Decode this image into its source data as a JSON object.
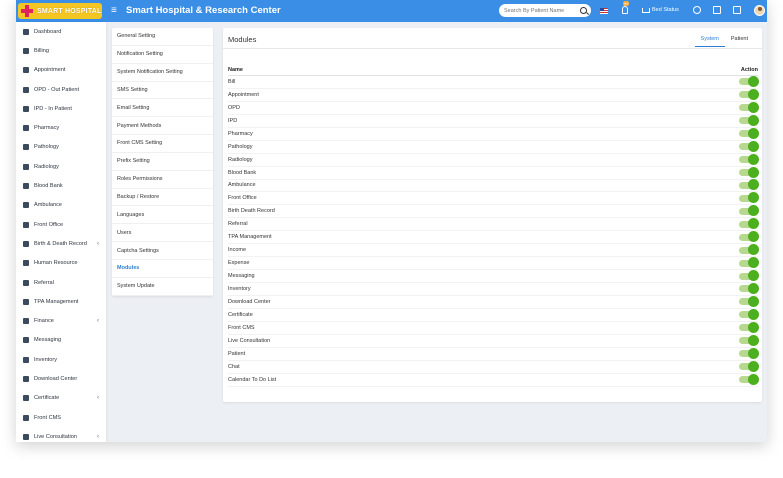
{
  "app": {
    "logo_text": "SMART HOSPITAL",
    "title": "Smart Hospital & Research Center",
    "menu_icon": "≡"
  },
  "topbar": {
    "search_placeholder": "Search By Patient Name",
    "notification_badge": "99",
    "bed_status_label": "Bed Status",
    "icons": [
      "us-flag-icon",
      "bell-icon",
      "bed-icon",
      "whatsapp-icon",
      "calendar-icon",
      "checkbox-icon",
      "user-avatar"
    ]
  },
  "sidebar": {
    "items": [
      {
        "label": "Dashboard",
        "icon": "monitor-icon",
        "has_submenu": false
      },
      {
        "label": "Billing",
        "icon": "file-icon",
        "has_submenu": false
      },
      {
        "label": "Appointment",
        "icon": "calendar-icon",
        "has_submenu": false
      },
      {
        "label": "OPD - Out Patient",
        "icon": "stethoscope-icon",
        "has_submenu": false
      },
      {
        "label": "IPD - In Patient",
        "icon": "bed-icon",
        "has_submenu": false
      },
      {
        "label": "Pharmacy",
        "icon": "mortar-icon",
        "has_submenu": false
      },
      {
        "label": "Pathology",
        "icon": "flask-icon",
        "has_submenu": false
      },
      {
        "label": "Radiology",
        "icon": "radiation-icon",
        "has_submenu": false
      },
      {
        "label": "Blood Bank",
        "icon": "drop-icon",
        "has_submenu": false
      },
      {
        "label": "Ambulance",
        "icon": "ambulance-icon",
        "has_submenu": false
      },
      {
        "label": "Front Office",
        "icon": "id-card-icon",
        "has_submenu": false
      },
      {
        "label": "Birth & Death Record",
        "icon": "family-icon",
        "has_submenu": true
      },
      {
        "label": "Human Resource",
        "icon": "sitemap-icon",
        "has_submenu": false
      },
      {
        "label": "Referral",
        "icon": "users-icon",
        "has_submenu": false
      },
      {
        "label": "TPA Management",
        "icon": "umbrella-icon",
        "has_submenu": false
      },
      {
        "label": "Finance",
        "icon": "money-icon",
        "has_submenu": true
      },
      {
        "label": "Messaging",
        "icon": "bullhorn-icon",
        "has_submenu": false
      },
      {
        "label": "Inventory",
        "icon": "box-icon",
        "has_submenu": false
      },
      {
        "label": "Download Center",
        "icon": "download-icon",
        "has_submenu": false
      },
      {
        "label": "Certificate",
        "icon": "certificate-icon",
        "has_submenu": true
      },
      {
        "label": "Front CMS",
        "icon": "newspaper-icon",
        "has_submenu": false
      },
      {
        "label": "Live Consultation",
        "icon": "video-icon",
        "has_submenu": true
      }
    ],
    "chevron": "‹"
  },
  "settings_menu": {
    "items": [
      "General Setting",
      "Notification Setting",
      "System Notification Setting",
      "SMS Setting",
      "Email Setting",
      "Payment Methods",
      "Front CMS Setting",
      "Prefix Setting",
      "Roles Permissions",
      "Backup / Restore",
      "Languages",
      "Users",
      "Captcha Settings",
      "Modules",
      "System Update"
    ],
    "active": "Modules"
  },
  "modules_panel": {
    "title": "Modules",
    "tabs": [
      {
        "label": "System",
        "active": true
      },
      {
        "label": "Patient",
        "active": false
      }
    ],
    "columns": {
      "name": "Name",
      "action": "Action"
    },
    "rows": [
      {
        "name": "Bill",
        "enabled": true
      },
      {
        "name": "Appointment",
        "enabled": true
      },
      {
        "name": "OPD",
        "enabled": true
      },
      {
        "name": "IPD",
        "enabled": true
      },
      {
        "name": "Pharmacy",
        "enabled": true
      },
      {
        "name": "Pathology",
        "enabled": true
      },
      {
        "name": "Radiology",
        "enabled": true
      },
      {
        "name": "Blood Bank",
        "enabled": true
      },
      {
        "name": "Ambulance",
        "enabled": true
      },
      {
        "name": "Front Office",
        "enabled": true
      },
      {
        "name": "Birth Death Record",
        "enabled": true
      },
      {
        "name": "Referral",
        "enabled": true
      },
      {
        "name": "TPA Management",
        "enabled": true
      },
      {
        "name": "Income",
        "enabled": true
      },
      {
        "name": "Expense",
        "enabled": true
      },
      {
        "name": "Messaging",
        "enabled": true
      },
      {
        "name": "Inventory",
        "enabled": true
      },
      {
        "name": "Download Center",
        "enabled": true
      },
      {
        "name": "Certificate",
        "enabled": true
      },
      {
        "name": "Front CMS",
        "enabled": true
      },
      {
        "name": "Live Consultation",
        "enabled": true
      },
      {
        "name": "Patient",
        "enabled": true
      },
      {
        "name": "Chat",
        "enabled": true
      },
      {
        "name": "Calendar To Do List",
        "enabled": true
      }
    ]
  },
  "colors": {
    "topbar": "#3a8ee6",
    "accent": "#2f7fd6",
    "toggle_on": "#4caf1e",
    "logo_bg": "#f3c623"
  }
}
